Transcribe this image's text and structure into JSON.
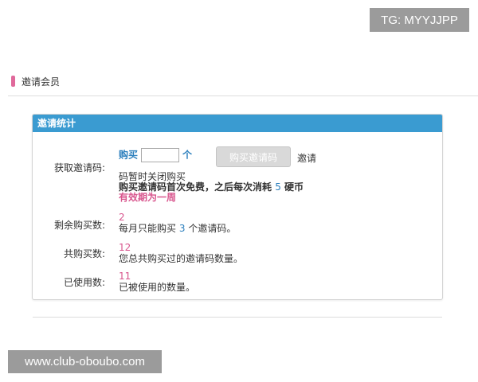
{
  "watermark": {
    "tg": "TG: MYYJJPP",
    "url": "www.club-oboubo.com"
  },
  "page": {
    "heading": "邀请会员"
  },
  "panel": {
    "title": "邀请统计",
    "invite_code": {
      "label": "获取邀请码:",
      "buy_word": "购买",
      "quantity_value": "",
      "unit_word": "个",
      "buy_button": "购买邀请码",
      "invite_word": "邀请",
      "closed_line": "码暂时关闭购买",
      "cost_prefix": "购买邀请码首次免费，之后每次消耗",
      "cost_amount": "5",
      "cost_suffix": "硬币",
      "validity": "有效期为一周"
    },
    "remaining": {
      "label": "剩余购买数:",
      "value": "2",
      "note_prefix": "每月只能购买",
      "note_amount": "3",
      "note_suffix": "个邀请码。"
    },
    "total": {
      "label": "共购买数:",
      "value": "12",
      "note": "您总共购买过的邀请码数量。"
    },
    "used": {
      "label": "已使用数:",
      "value": "11",
      "note": "已被使用的数量。"
    }
  },
  "colors": {
    "header_blue": "#3a9bd1",
    "accent_pink": "#d8558d",
    "link_blue": "#2b7fbd"
  }
}
